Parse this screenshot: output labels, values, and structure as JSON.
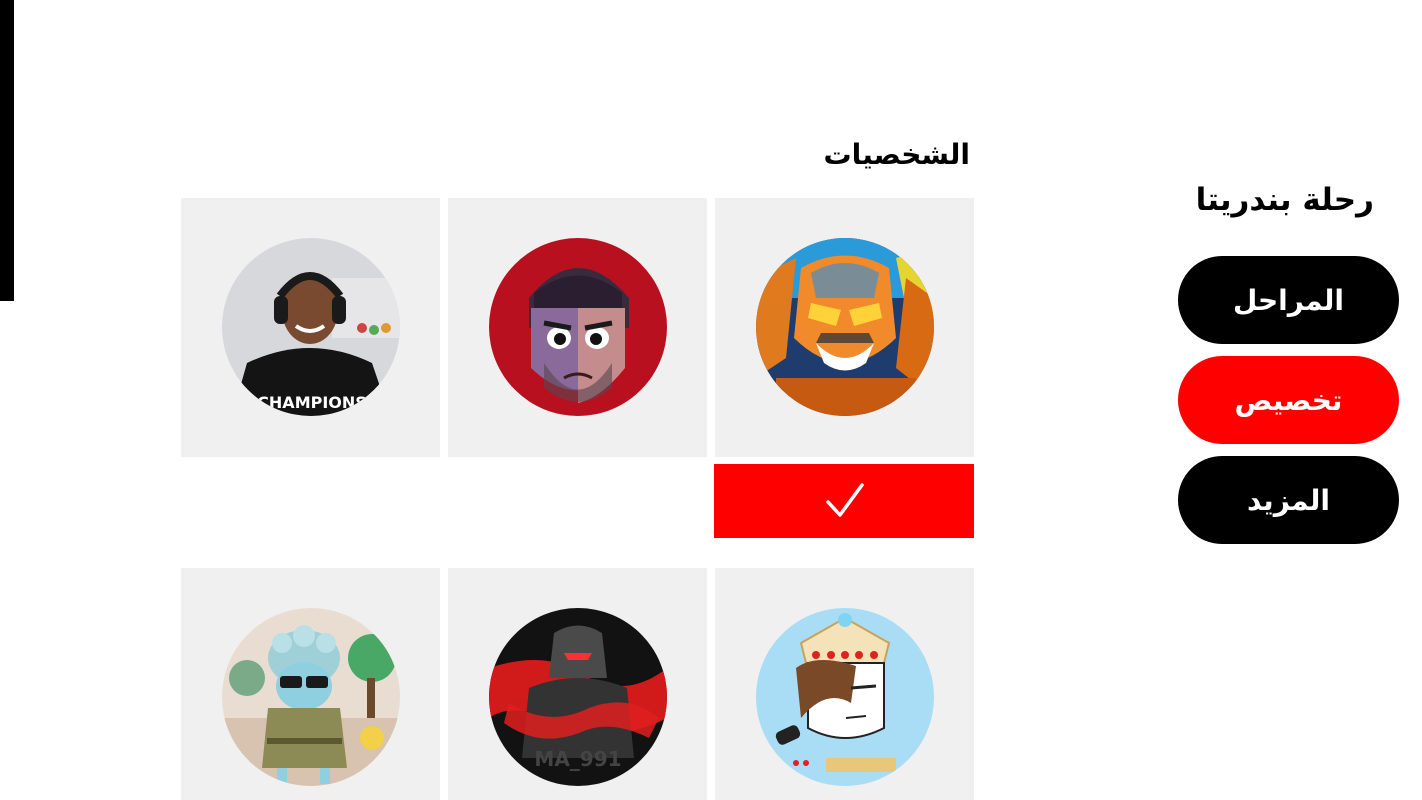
{
  "app": {
    "title": "رحلة بندريتا"
  },
  "sidebar": {
    "items": [
      {
        "label": "المراحل",
        "active": false
      },
      {
        "label": "تخصيص",
        "active": true
      },
      {
        "label": "المزيد",
        "active": false
      }
    ]
  },
  "characters": {
    "title": "الشخصيات",
    "selected_index": 0,
    "items": [
      {
        "avatar": "orange-robot-hero-avatar"
      },
      {
        "avatar": "cartoon-bearded-man-avatar"
      },
      {
        "avatar": "young-man-with-headphones-photo-avatar"
      },
      {
        "avatar": "crowned-boy-drawing-avatar"
      },
      {
        "avatar": "dark-knight-avatar",
        "caption": "MA_991"
      },
      {
        "avatar": "grandma-with-sunglasses-cartoon-avatar"
      }
    ],
    "selected_marker_icon": "checkmark-icon"
  },
  "colors": {
    "accent": "#ff0000",
    "button": "#000000",
    "tile_bg": "#f0f0f0"
  }
}
